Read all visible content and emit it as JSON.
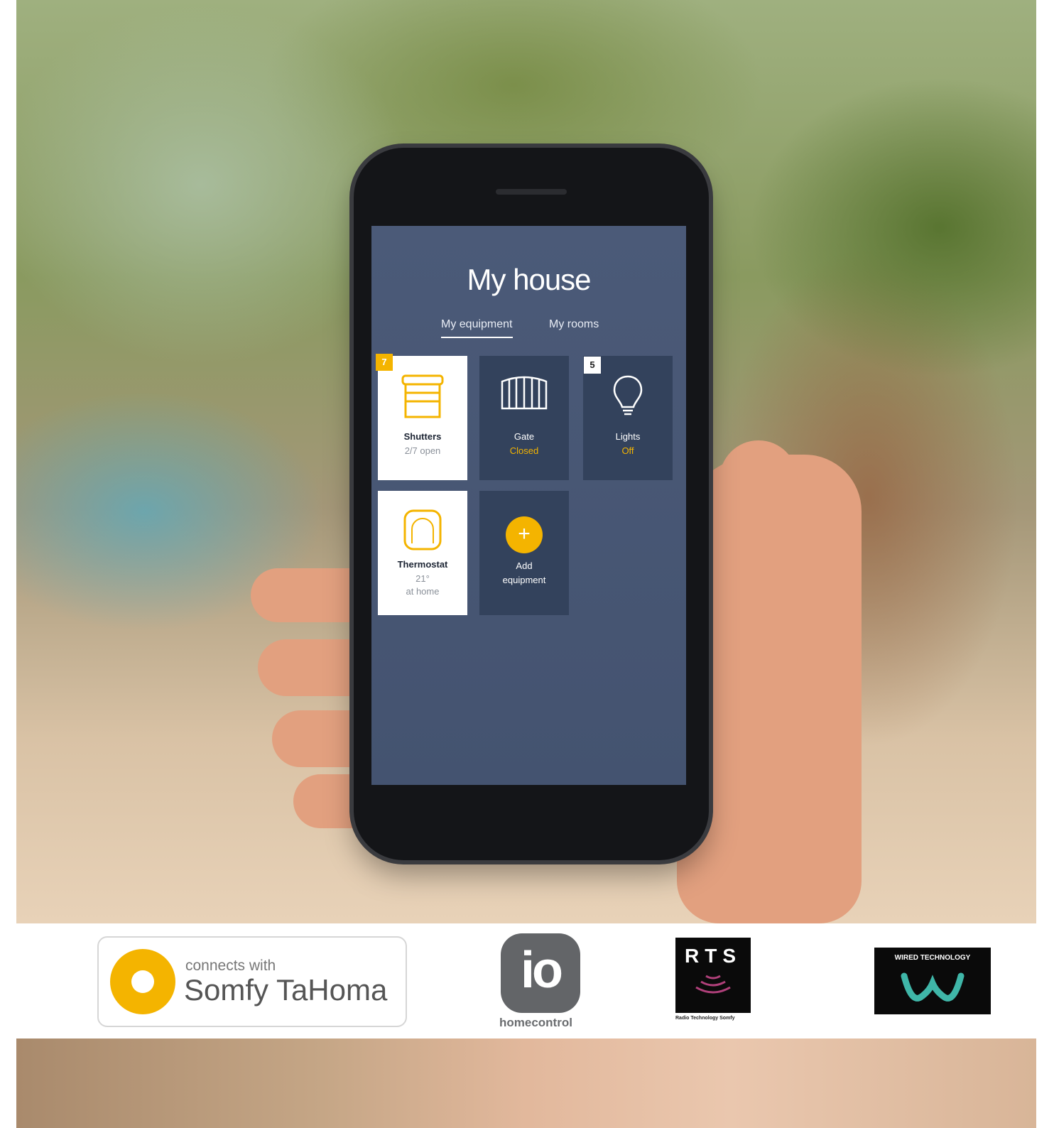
{
  "app": {
    "title": "My house",
    "tabs": [
      {
        "label": "My equipment",
        "active": true
      },
      {
        "label": "My rooms",
        "active": false
      }
    ],
    "tiles": [
      {
        "name": "Shutters",
        "status": "2/7 open",
        "badge": "7",
        "theme": "light",
        "icon": "shutter-icon"
      },
      {
        "name": "Gate",
        "status": "Closed",
        "theme": "dark",
        "icon": "gate-icon"
      },
      {
        "name": "Lights",
        "status": "Off",
        "badge": "5",
        "theme": "dark",
        "icon": "lightbulb-icon"
      },
      {
        "name": "Thermostat",
        "status": "21°",
        "status2": "at home",
        "theme": "light",
        "icon": "thermostat-icon"
      },
      {
        "name": "Add",
        "status": "equipment",
        "theme": "dark",
        "icon": "plus-icon"
      }
    ],
    "accent_color": "#f4b400",
    "screen_color": "#4b5a78",
    "tile_dark_color": "#33425c"
  },
  "logos": {
    "tahoma_small": "connects with",
    "tahoma_big": "Somfy TaHoma",
    "io_mark": "io",
    "io_text": "homecontrol",
    "rts_letters": "RTS",
    "rts_caption": "Radio Technology Somfy",
    "wired_text": "WIRED TECHNOLOGY"
  }
}
